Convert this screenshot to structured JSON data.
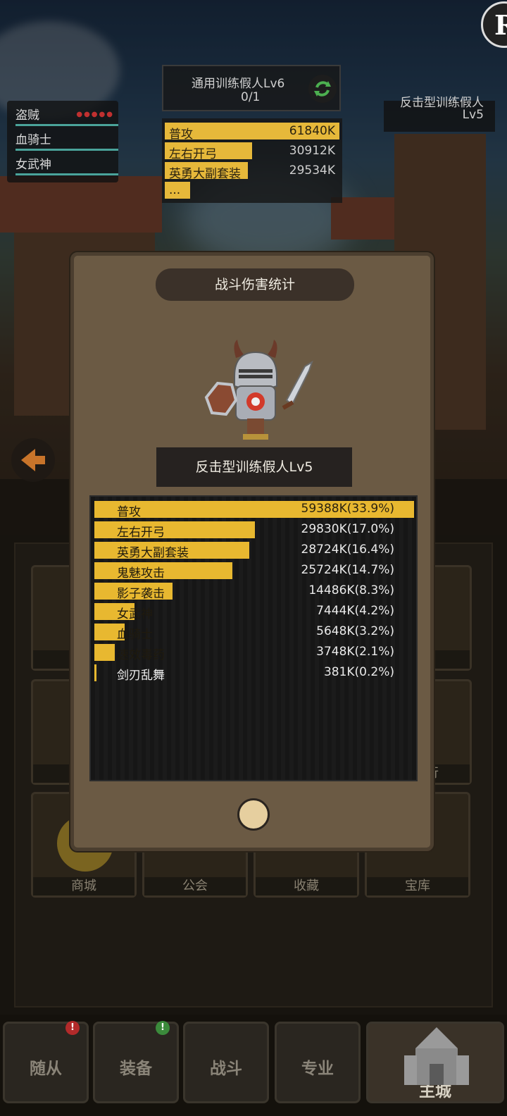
{
  "logo_letter": "R",
  "team": [
    {
      "name": "盗贼"
    },
    {
      "name": "血骑士"
    },
    {
      "name": "女武神"
    }
  ],
  "target": {
    "name": "通用训练假人Lv6",
    "count": "0/1"
  },
  "mini_stats": [
    {
      "label": "普攻",
      "value": "61840K",
      "fill": 1.0
    },
    {
      "label": "左右开弓",
      "value": "30912K",
      "fill": 0.5
    },
    {
      "label": "英勇大副套装",
      "value": "29534K",
      "fill": 0.48
    },
    {
      "label": "...",
      "value": "",
      "fill": 0.15
    }
  ],
  "right_target": {
    "line1": "反击型训练假人",
    "line2": "Lv5"
  },
  "tiles": [
    "商城",
    "公会",
    "收藏",
    "宝库"
  ],
  "tile_partial": "行",
  "nav": [
    {
      "label": "随从",
      "badge": "!",
      "badge_color": "#b22a2a"
    },
    {
      "label": "装备",
      "badge": "!",
      "badge_color": "#3b8a3b"
    },
    {
      "label": "战斗"
    },
    {
      "label": "专业"
    },
    {
      "label": "主城"
    }
  ],
  "dialog": {
    "title": "战斗伤害统计",
    "enemy": "反击型训练假人Lv5",
    "rows": [
      {
        "label": "普攻",
        "value": "59388K(33.9%)",
        "share": 1.0
      },
      {
        "label": "左右开弓",
        "value": "29830K(17.0%)",
        "share": 0.502
      },
      {
        "label": "英勇大副套装",
        "value": "28724K(16.4%)",
        "share": 0.484
      },
      {
        "label": "鬼魅攻击",
        "value": "25724K(14.7%)",
        "share": 0.433
      },
      {
        "label": "影子袭击",
        "value": "14486K(8.3%)",
        "share": 0.244
      },
      {
        "label": "女武神",
        "value": "7444K(4.2%)",
        "share": 0.125
      },
      {
        "label": "血骑士",
        "value": "5648K(3.2%)",
        "share": 0.095
      },
      {
        "label": "速效毒药",
        "value": "3748K(2.1%)",
        "share": 0.063
      },
      {
        "label": "剑刃乱舞",
        "value": "381K(0.2%)",
        "share": 0.006
      }
    ]
  }
}
